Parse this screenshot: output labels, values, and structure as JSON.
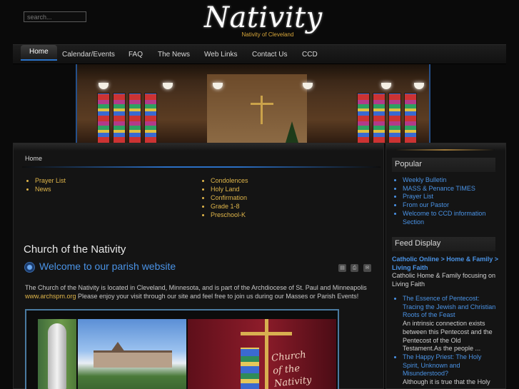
{
  "search": {
    "placeholder": "search..."
  },
  "logo": {
    "title": "Nativity",
    "subtitle": "Nativity of Cleveland"
  },
  "nav": {
    "items": [
      "Home",
      "Calendar/Events",
      "FAQ",
      "The News",
      "Web Links",
      "Contact Us",
      "CCD"
    ]
  },
  "breadcrumb": "Home",
  "main": {
    "left_list": [
      "Prayer List",
      "News"
    ],
    "right_list": [
      "Condolences",
      "Holy Land",
      "Confirmation",
      "Grade 1-8",
      "Preschool-K"
    ],
    "page_title": "Church of the Nativity",
    "welcome": "Welcome to our parish website",
    "intro_before": "The Church of the Nativity is located in Cleveland, Minnesota, and is part of the Archdiocese of St. Paul and Minneapolis",
    "intro_link": "www.archspm.org",
    "intro_after": " Please enjoy your visit through our site and feel free to join us during our Masses or Parish Events!",
    "photo_caption_line1": "Church",
    "photo_caption_line2": "of the Nativity"
  },
  "sidebar": {
    "popular_title": "Popular",
    "popular_items": [
      "Weekly Bulletin",
      "MASS & Penance TIMES",
      "Prayer List",
      "From our Pastor",
      "Welcome to CCD information Section"
    ],
    "feed_title": "Feed Display",
    "feed_source": "Catholic Online > Home & Family > Living Faith",
    "feed_source_desc": "Catholic Home & Family focusing on Living Faith",
    "feed_items": [
      {
        "title": "The Essence of Pentecost: Tracing the Jewish and Christian Roots of the Feast",
        "body": "An intrinsic connection exists between this Pentecost and the Pentecost of the Old Testament.As the people ..."
      },
      {
        "title": "The Happy Priest: The Holy Spirit, Unknown and Misunderstood?",
        "body": "Although it is true that the Holy"
      }
    ]
  },
  "colors": {
    "link_gold": "#e0b64a",
    "link_blue": "#4a93e6",
    "accent_blue": "#2b6fc4"
  },
  "icons": {
    "pdf": "pdf-icon",
    "print": "print-icon",
    "email": "email-icon"
  }
}
